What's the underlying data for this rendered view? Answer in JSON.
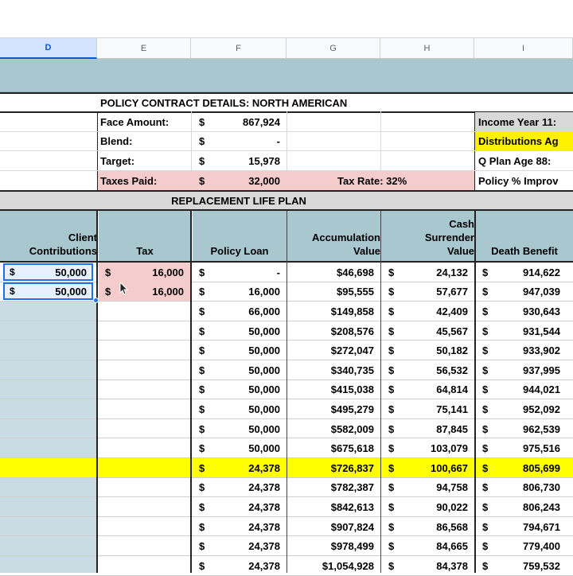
{
  "columns": [
    "D",
    "E",
    "F",
    "G",
    "H",
    "I"
  ],
  "policy": {
    "title": "POLICY CONTRACT DETAILS:  NORTH AMERICAN",
    "face_label": "Face Amount:",
    "face_sym": "$",
    "face_value": "867,924",
    "blend_label": "Blend:",
    "blend_sym": "$",
    "blend_value": "-",
    "target_label": "Target:",
    "target_sym": "$",
    "target_value": "15,978",
    "taxes_label": "Taxes Paid:",
    "taxes_sym": "$",
    "taxes_value": "32,000",
    "tax_rate": "Tax Rate: 32%"
  },
  "side_labels": [
    "Income Year 11:",
    "Distributions Ag",
    "Q Plan Age 88:",
    "Policy % Improv"
  ],
  "section_title": "REPLACEMENT LIFE PLAN",
  "headers": {
    "client": [
      "Client",
      "Contributions"
    ],
    "tax": "Tax",
    "loan": "Policy Loan",
    "accum": [
      "Accumulation",
      "Value"
    ],
    "cash": [
      "Cash",
      "Surrender",
      "Value"
    ],
    "death": "Death Benefit"
  },
  "contrib_rows": [
    {
      "sym": "$",
      "value": "50,000",
      "tax_sym": "$",
      "tax": "16,000"
    },
    {
      "sym": "$",
      "value": "50,000",
      "tax_sym": "$",
      "tax": "16,000"
    }
  ],
  "rows": [
    {
      "loan_sym": "$",
      "loan": "-",
      "accum": "$46,698",
      "cash_sym": "$",
      "cash": "24,132",
      "death_sym": "$",
      "death": "914,622"
    },
    {
      "loan_sym": "$",
      "loan": "16,000",
      "accum": "$95,555",
      "cash_sym": "$",
      "cash": "57,677",
      "death_sym": "$",
      "death": "947,039"
    },
    {
      "loan_sym": "$",
      "loan": "66,000",
      "accum": "$149,858",
      "cash_sym": "$",
      "cash": "42,409",
      "death_sym": "$",
      "death": "930,643"
    },
    {
      "loan_sym": "$",
      "loan": "50,000",
      "accum": "$208,576",
      "cash_sym": "$",
      "cash": "45,567",
      "death_sym": "$",
      "death": "931,544"
    },
    {
      "loan_sym": "$",
      "loan": "50,000",
      "accum": "$272,047",
      "cash_sym": "$",
      "cash": "50,182",
      "death_sym": "$",
      "death": "933,902"
    },
    {
      "loan_sym": "$",
      "loan": "50,000",
      "accum": "$340,735",
      "cash_sym": "$",
      "cash": "56,532",
      "death_sym": "$",
      "death": "937,995"
    },
    {
      "loan_sym": "$",
      "loan": "50,000",
      "accum": "$415,038",
      "cash_sym": "$",
      "cash": "64,814",
      "death_sym": "$",
      "death": "944,021"
    },
    {
      "loan_sym": "$",
      "loan": "50,000",
      "accum": "$495,279",
      "cash_sym": "$",
      "cash": "75,141",
      "death_sym": "$",
      "death": "952,092"
    },
    {
      "loan_sym": "$",
      "loan": "50,000",
      "accum": "$582,009",
      "cash_sym": "$",
      "cash": "87,845",
      "death_sym": "$",
      "death": "962,539"
    },
    {
      "loan_sym": "$",
      "loan": "50,000",
      "accum": "$675,618",
      "cash_sym": "$",
      "cash": "103,079",
      "death_sym": "$",
      "death": "975,516"
    },
    {
      "loan_sym": "$",
      "loan": "24,378",
      "accum": "$726,837",
      "cash_sym": "$",
      "cash": "100,667",
      "death_sym": "$",
      "death": "805,699",
      "highlight": true
    },
    {
      "loan_sym": "$",
      "loan": "24,378",
      "accum": "$782,387",
      "cash_sym": "$",
      "cash": "94,758",
      "death_sym": "$",
      "death": "806,730"
    },
    {
      "loan_sym": "$",
      "loan": "24,378",
      "accum": "$842,613",
      "cash_sym": "$",
      "cash": "90,022",
      "death_sym": "$",
      "death": "806,243"
    },
    {
      "loan_sym": "$",
      "loan": "24,378",
      "accum": "$907,824",
      "cash_sym": "$",
      "cash": "86,568",
      "death_sym": "$",
      "death": "794,671"
    },
    {
      "loan_sym": "$",
      "loan": "24,378",
      "accum": "$978,499",
      "cash_sym": "$",
      "cash": "84,665",
      "death_sym": "$",
      "death": "779,400"
    },
    {
      "loan_sym": "$",
      "loan": "24,378",
      "accum": "$1,054,928",
      "cash_sym": "$",
      "cash": "84,378",
      "death_sym": "$",
      "death": "759,532"
    }
  ],
  "colors": {
    "header_teal": "#a9c7cf",
    "highlight": "#ffff00",
    "tax_pink": "#f4cccc",
    "selection": "#1a73e8"
  }
}
